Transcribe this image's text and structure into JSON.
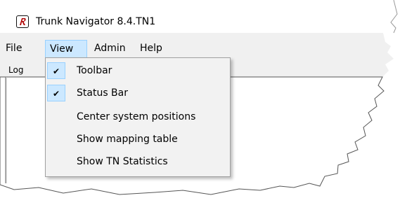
{
  "window": {
    "app_icon": "app-logo-icon",
    "title": "Trunk Navigator 8.4.TN1"
  },
  "menubar": {
    "items": [
      {
        "label": "File"
      },
      {
        "label": "View",
        "active": true
      },
      {
        "label": "Admin"
      },
      {
        "label": "Help"
      }
    ]
  },
  "toolbar": {
    "text": "Log"
  },
  "view_menu": {
    "items": [
      {
        "label": "Toolbar",
        "checked": true
      },
      {
        "label": "Status Bar",
        "checked": true
      },
      {
        "label": "Center system positions",
        "checked": false
      },
      {
        "label": "Show mapping table",
        "checked": false
      },
      {
        "label": "Show TN Statistics",
        "checked": false
      }
    ],
    "check_icon": "check-icon"
  },
  "colors": {
    "menubar_bg": "#f0f0f0",
    "highlight_bg": "#cce8ff",
    "highlight_border": "#99d1ff",
    "menu_bg": "#f2f2f2"
  }
}
